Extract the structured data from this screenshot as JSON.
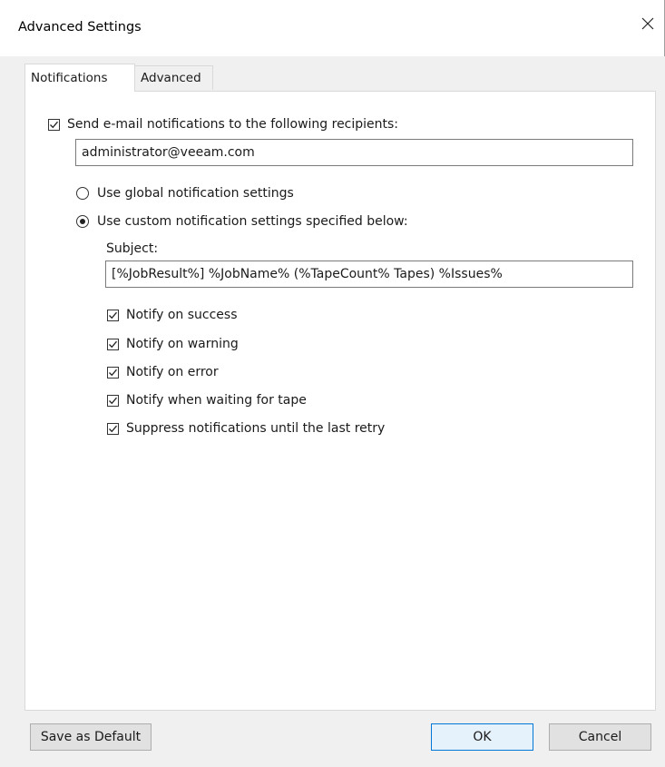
{
  "window": {
    "title": "Advanced Settings"
  },
  "tabs": [
    {
      "label": "Notifications",
      "active": true
    },
    {
      "label": "Advanced",
      "active": false
    }
  ],
  "notifications": {
    "send_email": {
      "label": "Send e-mail notifications to the following recipients:",
      "checked": true
    },
    "recipients_value": "administrator@veeam.com",
    "use_global": {
      "label": "Use global notification settings",
      "selected": false
    },
    "use_custom": {
      "label": "Use custom notification settings specified below:",
      "selected": true
    },
    "subject_label": "Subject:",
    "subject_value": "[%JobResult%] %JobName% (%TapeCount% Tapes) %Issues%",
    "options": [
      {
        "label": "Notify on success",
        "checked": true
      },
      {
        "label": "Notify on warning",
        "checked": true
      },
      {
        "label": "Notify on error",
        "checked": true
      },
      {
        "label": "Notify when waiting for tape",
        "checked": true
      },
      {
        "label": "Suppress notifications until the last retry",
        "checked": true
      }
    ]
  },
  "footer": {
    "save_default_label": "Save as Default",
    "ok_label": "OK",
    "cancel_label": "Cancel"
  },
  "colors": {
    "accent": "#0078d7",
    "dialog_bg": "#f0f0f0"
  }
}
